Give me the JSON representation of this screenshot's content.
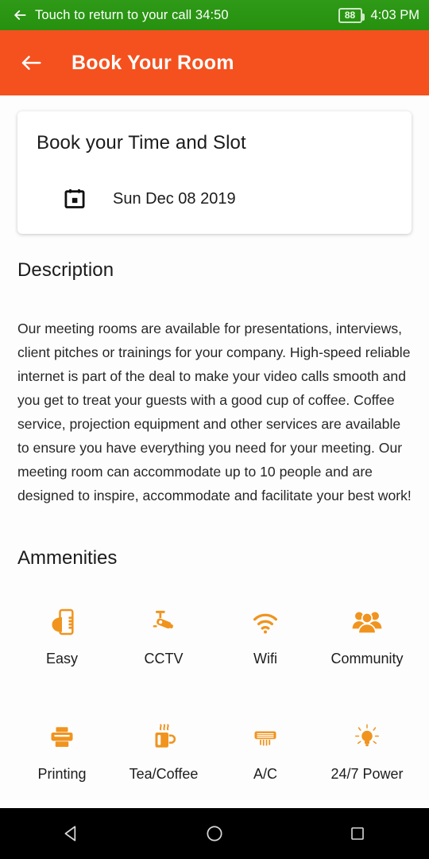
{
  "statusbar": {
    "back_icon": "arrow-left-icon",
    "call_text": "Touch to return to your call 34:50",
    "battery_level": "88",
    "time": "4:03 PM",
    "bg_color": "#2e9a18"
  },
  "appbar": {
    "back_icon": "arrow-left-icon",
    "title": "Book Your Room",
    "bg_color": "#f4511e"
  },
  "booking_card": {
    "title": "Book your Time and Slot",
    "date_icon": "calendar-icon",
    "date": "Sun Dec 08 2019"
  },
  "description_section": {
    "heading": "Description",
    "body": "Our meeting rooms are available for presentations, interviews, client pitches or trainings for your company. High-speed reliable internet is part of the deal to make your video calls smooth and you get to treat your guests with a good cup of coffee. Coffee service, projection equipment and other services are available to ensure you have everything you need for your meeting. Our meeting room can accommodate up to 10 people and are designed to inspire, accommodate and facilitate your best work!"
  },
  "amenities_section": {
    "heading": "Ammenities",
    "accent_color": "#f0941f",
    "items": [
      {
        "label": "Easy",
        "icon": "hand-phone-icon"
      },
      {
        "label": "CCTV",
        "icon": "security-camera-icon"
      },
      {
        "label": "Wifi",
        "icon": "wifi-icon"
      },
      {
        "label": "Community",
        "icon": "people-group-icon"
      },
      {
        "label": "Printing",
        "icon": "printer-icon"
      },
      {
        "label": "Tea/Coffee",
        "icon": "coffee-cup-icon"
      },
      {
        "label": "A/C",
        "icon": "air-conditioner-icon"
      },
      {
        "label": "24/7 Power",
        "icon": "light-bulb-icon"
      }
    ]
  },
  "navbar": {
    "back_label": "Back",
    "home_label": "Home",
    "recents_label": "Recents"
  }
}
